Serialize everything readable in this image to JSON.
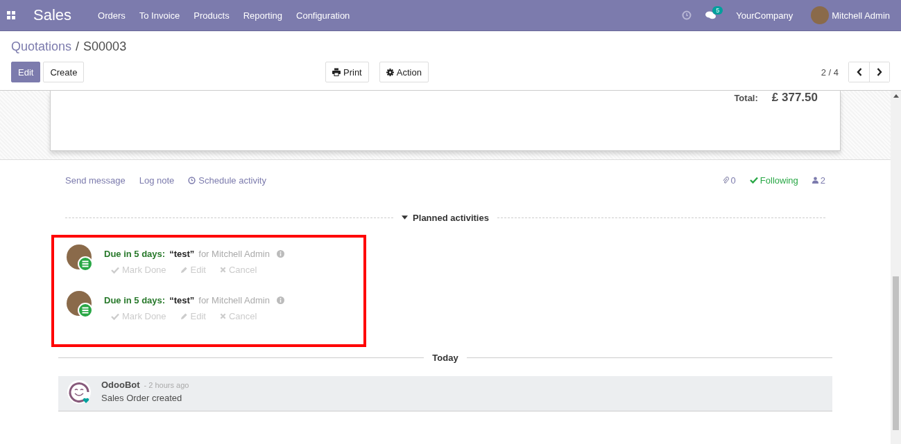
{
  "navbar": {
    "app_name": "Sales",
    "menu": [
      "Orders",
      "To Invoice",
      "Products",
      "Reporting",
      "Configuration"
    ],
    "message_count": "5",
    "company": "YourCompany",
    "user": "Mitchell Admin"
  },
  "breadcrumb": {
    "parent": "Quotations",
    "separator": "/",
    "current": "S00003"
  },
  "buttons": {
    "left": [
      "Edit",
      "Create"
    ],
    "center": [
      "Print",
      "Action"
    ]
  },
  "pager": {
    "value": "2 / 4"
  },
  "sheet": {
    "total_label": "Total:",
    "total_value": "£ 377.50"
  },
  "chatter": {
    "actions": [
      "Send message",
      "Log note",
      "Schedule activity"
    ],
    "attachments": "0",
    "following": "Following",
    "followers": "2"
  },
  "planned": {
    "title": "Planned activities",
    "expanded": true,
    "activities": [
      {
        "due": "Due in 5 days:",
        "summary": "“test”",
        "assignee": "for Mitchell Admin",
        "actions": [
          "Mark Done",
          "Edit",
          "Cancel"
        ]
      },
      {
        "due": "Due in 5 days:",
        "summary": "“test”",
        "assignee": "for Mitchell Admin",
        "actions": [
          "Mark Done",
          "Edit",
          "Cancel"
        ]
      }
    ]
  },
  "separator": "Today",
  "messages": [
    {
      "author": "OdooBot",
      "date": "- 2 hours ago",
      "body": "Sales Order created"
    }
  ]
}
